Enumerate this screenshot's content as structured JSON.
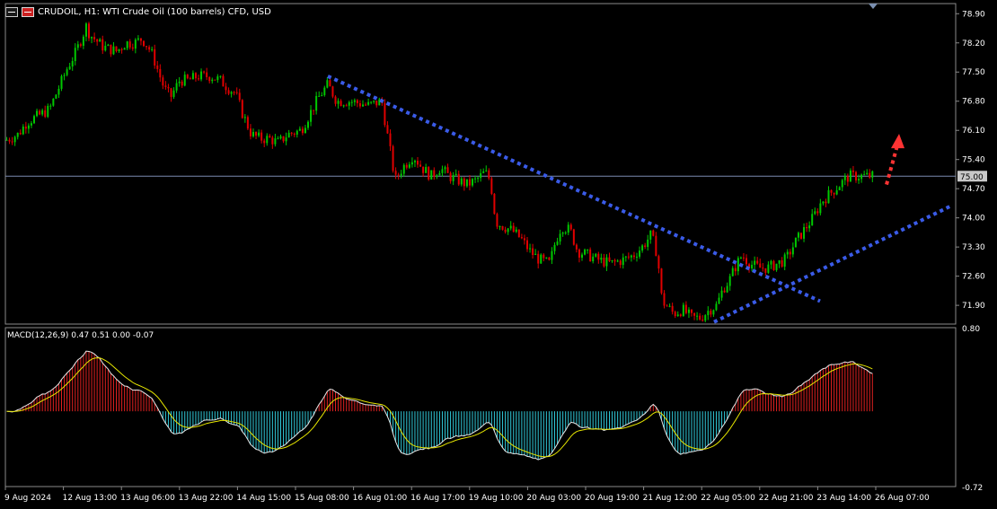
{
  "header": {
    "symbol_text": "CRUDOIL, H1:  WTI Crude Oil (100 barrels) CFD, USD"
  },
  "macd": {
    "title": "MACD(12,26,9) 0.47 0.51 0.00 -0.07"
  },
  "colors": {
    "background": "#000000",
    "bull_candle": "#00c800",
    "bear_candle": "#e00000",
    "trendline": "#3a5be8",
    "arrow": "#ff3333",
    "macd_hist_pos": "#e02020",
    "macd_hist_neg": "#30c8d8",
    "macd_line": "#e6e6e6",
    "signal_line": "#e6e600"
  },
  "price_axis": {
    "ticks": [
      "78.90",
      "78.20",
      "77.50",
      "76.80",
      "76.10",
      "75.40",
      "74.70",
      "74.00",
      "73.30",
      "72.60",
      "71.90"
    ],
    "current_price": "75.00",
    "range": [
      71.45,
      79.1
    ]
  },
  "macd_axis": {
    "ticks": [
      "0.80",
      "-0.72"
    ],
    "range": [
      -0.72,
      0.8
    ]
  },
  "time_axis": {
    "labels": [
      "9 Aug 2024",
      "12 Aug 13:00",
      "13 Aug 06:00",
      "13 Aug 22:00",
      "14 Aug 15:00",
      "15 Aug 08:00",
      "16 Aug 01:00",
      "16 Aug 17:00",
      "19 Aug 10:00",
      "20 Aug 03:00",
      "20 Aug 19:00",
      "21 Aug 12:00",
      "22 Aug 05:00",
      "22 Aug 21:00",
      "23 Aug 14:00",
      "26 Aug 07:00"
    ]
  },
  "chart_data": {
    "type": "candlestick",
    "symbol": "CRUDOIL",
    "timeframe": "H1",
    "close_anchors": [
      [
        0,
        75.8
      ],
      [
        20,
        76.0
      ],
      [
        30,
        76.3
      ],
      [
        55,
        76.6
      ],
      [
        75,
        77.6
      ],
      [
        85,
        78.0
      ],
      [
        96,
        78.6
      ],
      [
        100,
        78.4
      ],
      [
        115,
        78.1
      ],
      [
        130,
        78.0
      ],
      [
        140,
        78.2
      ],
      [
        150,
        78.2
      ],
      [
        158,
        78.3
      ],
      [
        165,
        78.1
      ],
      [
        170,
        77.9
      ],
      [
        178,
        77.4
      ],
      [
        183,
        77.1
      ],
      [
        190,
        76.9
      ],
      [
        200,
        77.3
      ],
      [
        210,
        77.3
      ],
      [
        220,
        77.4
      ],
      [
        235,
        77.4
      ],
      [
        245,
        77.3
      ],
      [
        255,
        77.1
      ],
      [
        262,
        77.0
      ],
      [
        270,
        76.5
      ],
      [
        280,
        76.0
      ],
      [
        290,
        75.9
      ],
      [
        300,
        75.9
      ],
      [
        310,
        75.8
      ],
      [
        320,
        76.0
      ],
      [
        335,
        76.1
      ],
      [
        345,
        76.5
      ],
      [
        355,
        76.9
      ],
      [
        365,
        77.2
      ],
      [
        375,
        76.8
      ],
      [
        390,
        76.8
      ],
      [
        410,
        76.7
      ],
      [
        425,
        76.8
      ],
      [
        432,
        75.9
      ],
      [
        440,
        74.9
      ],
      [
        448,
        75.2
      ],
      [
        460,
        75.5
      ],
      [
        470,
        75.2
      ],
      [
        480,
        75.0
      ],
      [
        490,
        75.2
      ],
      [
        500,
        75.0
      ],
      [
        510,
        74.9
      ],
      [
        520,
        74.8
      ],
      [
        530,
        74.9
      ],
      [
        540,
        75.1
      ],
      [
        546,
        74.9
      ],
      [
        552,
        73.9
      ],
      [
        560,
        73.8
      ],
      [
        570,
        73.7
      ],
      [
        580,
        73.5
      ],
      [
        590,
        73.2
      ],
      [
        600,
        73.0
      ],
      [
        612,
        72.9
      ],
      [
        618,
        73.4
      ],
      [
        625,
        73.8
      ],
      [
        635,
        73.7
      ],
      [
        643,
        73.2
      ],
      [
        655,
        73.1
      ],
      [
        665,
        73.0
      ],
      [
        680,
        72.9
      ],
      [
        695,
        73.0
      ],
      [
        705,
        73.1
      ],
      [
        715,
        73.3
      ],
      [
        725,
        73.6
      ],
      [
        732,
        73.1
      ],
      [
        737,
        72.0
      ],
      [
        742,
        71.9
      ],
      [
        750,
        71.7
      ],
      [
        760,
        71.8
      ],
      [
        770,
        71.6
      ],
      [
        780,
        71.6
      ],
      [
        790,
        71.8
      ],
      [
        798,
        71.9
      ],
      [
        805,
        72.3
      ],
      [
        812,
        72.5
      ],
      [
        818,
        72.8
      ],
      [
        826,
        73.1
      ],
      [
        835,
        72.9
      ],
      [
        845,
        72.8
      ],
      [
        855,
        72.8
      ],
      [
        865,
        72.9
      ],
      [
        875,
        73.0
      ],
      [
        885,
        73.4
      ],
      [
        895,
        73.7
      ],
      [
        905,
        74.0
      ],
      [
        915,
        74.4
      ],
      [
        925,
        74.6
      ],
      [
        935,
        74.8
      ],
      [
        945,
        75.0
      ],
      [
        955,
        75.0
      ],
      [
        965,
        75.0
      ],
      [
        973,
        75.0
      ]
    ],
    "trendlines": [
      {
        "name": "resistance",
        "from": [
          365,
          77.4
        ],
        "to": [
          913,
          72.0
        ]
      },
      {
        "name": "support",
        "from": [
          795,
          71.5
        ],
        "to": [
          1060,
          74.3
        ]
      }
    ],
    "arrow": {
      "from": [
        987,
        74.8
      ],
      "to": [
        1000,
        75.95
      ]
    },
    "current_price_line": 75.0
  }
}
